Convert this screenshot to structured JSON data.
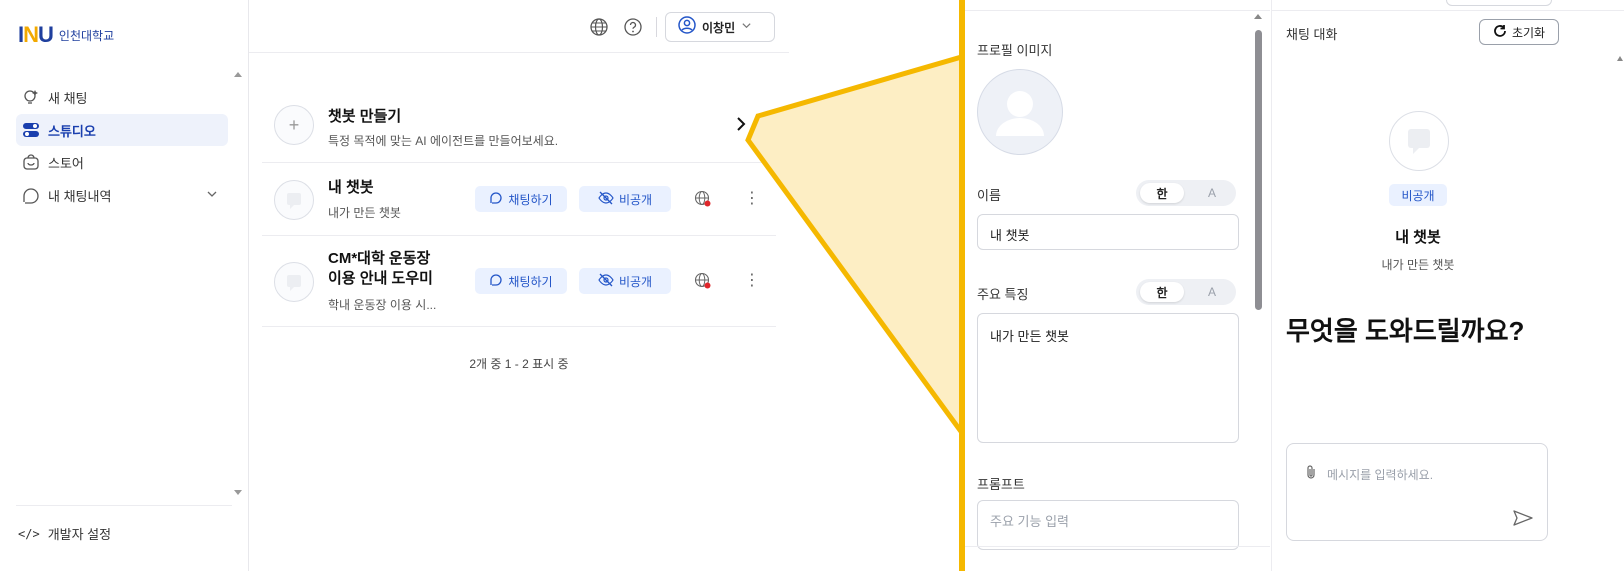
{
  "brand": {
    "logo_text": "INU",
    "school_name": "인천대학교"
  },
  "sidebar": {
    "items": [
      {
        "label": "새 채팅",
        "icon": "bulb-sparkle-icon"
      },
      {
        "label": "스튜디오",
        "icon": "toggle-icon"
      },
      {
        "label": "스토어",
        "icon": "bag-icon"
      },
      {
        "label": "내 채팅내역",
        "icon": "chat-history-icon"
      }
    ],
    "footer_label": "개발자 설정",
    "footer_icon": "code-icon"
  },
  "header": {
    "user_name": "이창민"
  },
  "studio": {
    "create": {
      "title": "챗봇 만들기",
      "subtitle": "특정 목적에 맞는 AI 에이전트를 만들어보세요."
    },
    "bots": [
      {
        "title": "내 챗봇",
        "subtitle": "내가 만든 챗봇",
        "chat_label": "채팅하기",
        "visibility_label": "비공개"
      },
      {
        "title_line1": "CM*대학 운동장",
        "title_line2": "이용 안내 도우미",
        "subtitle": "학내 운동장 이용 시...",
        "chat_label": "채팅하기",
        "visibility_label": "비공개"
      }
    ],
    "pagination": "2개 중 1 - 2 표시 중"
  },
  "editor": {
    "profile_image_label": "프로필 이미지",
    "name_label": "이름",
    "name_value": "내 챗봇",
    "feature_label": "주요 특징",
    "feature_value": "내가 만든 챗봇",
    "prompt_label": "프롬프트",
    "prompt_placeholder": "주요 기능 입력",
    "lang_on": "한",
    "lang_off": "A"
  },
  "chat": {
    "title": "채팅 대화",
    "reset_label": "초기화",
    "badge": "비공개",
    "bot_name": "내 챗봇",
    "bot_desc": "내가 만든 챗봇",
    "headline": "무엇을 도와드릴까요?",
    "input_placeholder": "메시지를 입력하세요."
  },
  "colors": {
    "highlight_border": "#f5b800",
    "highlight_fill": "#fdeec4",
    "accent": "#2456c8",
    "pill_bg": "#eaf1ff"
  }
}
